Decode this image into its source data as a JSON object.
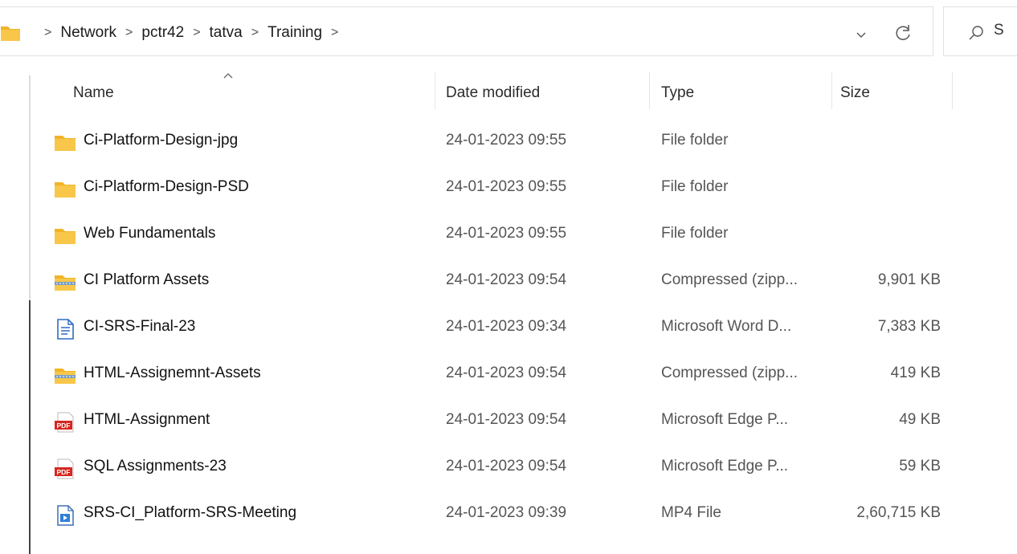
{
  "breadcrumb": {
    "items": [
      "Network",
      "pctr42",
      "tatva",
      "Training"
    ],
    "separator": ">",
    "trailing_separator": ">"
  },
  "search": {
    "visible_text": "S"
  },
  "colors": {
    "folder": "#F8C74A",
    "pdf_red": "#D7261E",
    "doc_blue": "#2B6CC4"
  },
  "columns": {
    "name": "Name",
    "date": "Date modified",
    "type": "Type",
    "size": "Size"
  },
  "sort": {
    "column": "name",
    "direction": "ascending"
  },
  "files": [
    {
      "name": "Ci-Platform-Design-jpg",
      "date": "24-01-2023 09:55",
      "type": "File folder",
      "size": "",
      "icon": "folder-icon"
    },
    {
      "name": "Ci-Platform-Design-PSD",
      "date": "24-01-2023 09:55",
      "type": "File folder",
      "size": "",
      "icon": "folder-icon"
    },
    {
      "name": "Web Fundamentals",
      "date": "24-01-2023 09:55",
      "type": "File folder",
      "size": "",
      "icon": "folder-icon"
    },
    {
      "name": "CI Platform Assets",
      "date": "24-01-2023 09:54",
      "type": "Compressed (zipp...",
      "size": "9,901 KB",
      "icon": "zip-folder-icon"
    },
    {
      "name": "CI-SRS-Final-23",
      "date": "24-01-2023 09:34",
      "type": "Microsoft Word D...",
      "size": "7,383 KB",
      "icon": "word-document-icon"
    },
    {
      "name": "HTML-Assignemnt-Assets",
      "date": "24-01-2023 09:54",
      "type": "Compressed (zipp...",
      "size": "419 KB",
      "icon": "zip-folder-icon"
    },
    {
      "name": "HTML-Assignment",
      "date": "24-01-2023 09:54",
      "type": "Microsoft Edge P...",
      "size": "49 KB",
      "icon": "pdf-icon"
    },
    {
      "name": "SQL Assignments-23",
      "date": "24-01-2023 09:54",
      "type": "Microsoft Edge P...",
      "size": "59 KB",
      "icon": "pdf-icon"
    },
    {
      "name": "SRS-CI_Platform-SRS-Meeting",
      "date": "24-01-2023 09:39",
      "type": "MP4 File",
      "size": "2,60,715 KB",
      "icon": "video-file-icon"
    }
  ]
}
